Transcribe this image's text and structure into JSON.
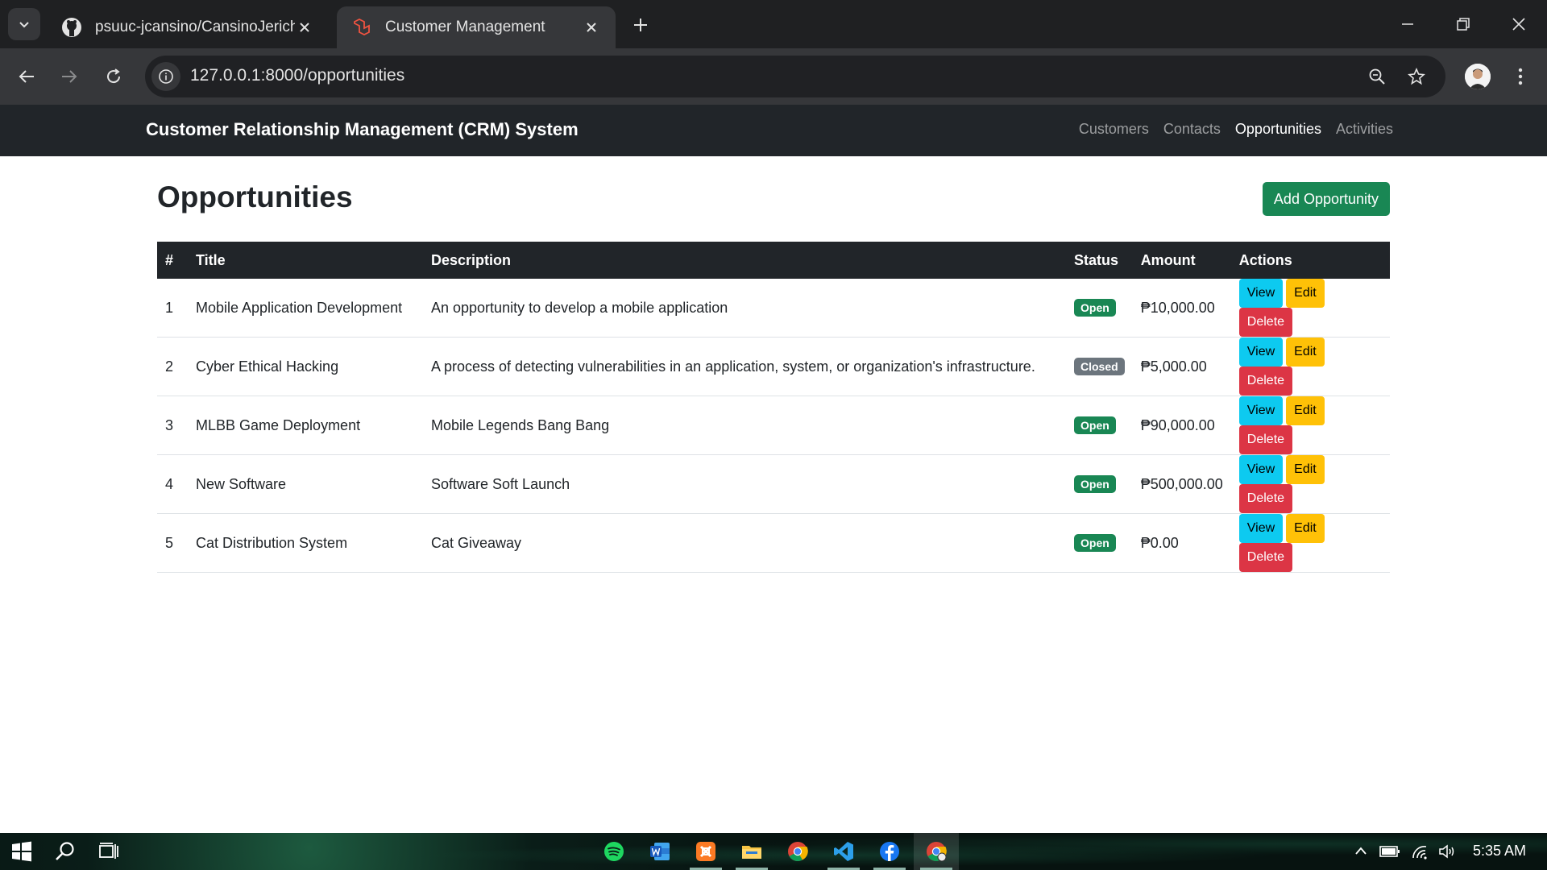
{
  "browser": {
    "tabs": [
      {
        "title": "psuuc-jcansino/CansinoJericho",
        "icon": "github-icon",
        "active": false
      },
      {
        "title": "Customer Management",
        "icon": "laravel-icon",
        "active": true
      }
    ],
    "url": "127.0.0.1:8000/opportunities"
  },
  "navbar": {
    "brand": "Customer Relationship Management (CRM) System",
    "links": [
      "Customers",
      "Contacts",
      "Opportunities",
      "Activities"
    ],
    "active_link": "Opportunities"
  },
  "page": {
    "title": "Opportunities",
    "add_button": "Add Opportunity"
  },
  "table": {
    "headers": [
      "#",
      "Title",
      "Description",
      "Status",
      "Amount",
      "Actions"
    ],
    "actions": {
      "view": "View",
      "edit": "Edit",
      "delete": "Delete"
    },
    "rows": [
      {
        "id": "1",
        "title": "Mobile Application Development",
        "description": "An opportunity to develop a mobile application",
        "status": "Open",
        "amount": "₱10,000.00"
      },
      {
        "id": "2",
        "title": "Cyber Ethical Hacking",
        "description": "A process of detecting vulnerabilities in an application, system, or organization's infrastructure.",
        "status": "Closed",
        "amount": "₱5,000.00"
      },
      {
        "id": "3",
        "title": "MLBB Game Deployment",
        "description": "Mobile Legends Bang Bang",
        "status": "Open",
        "amount": "₱90,000.00"
      },
      {
        "id": "4",
        "title": "New Software",
        "description": "Software Soft Launch",
        "status": "Open",
        "amount": "₱500,000.00"
      },
      {
        "id": "5",
        "title": "Cat Distribution System",
        "description": "Cat Giveaway",
        "status": "Open",
        "amount": "₱0.00"
      }
    ]
  },
  "taskbar": {
    "time": "5:35 AM",
    "apps": [
      "spotify-icon",
      "word-icon",
      "xampp-icon",
      "file-explorer-icon",
      "chrome-icon",
      "vscode-icon",
      "facebook-icon",
      "chrome-profile-icon"
    ]
  },
  "colors": {
    "success": "#198754",
    "secondary": "#6c757d",
    "info": "#0dcaf0",
    "warning": "#ffc107",
    "danger": "#dc3545",
    "dark": "#212529"
  }
}
